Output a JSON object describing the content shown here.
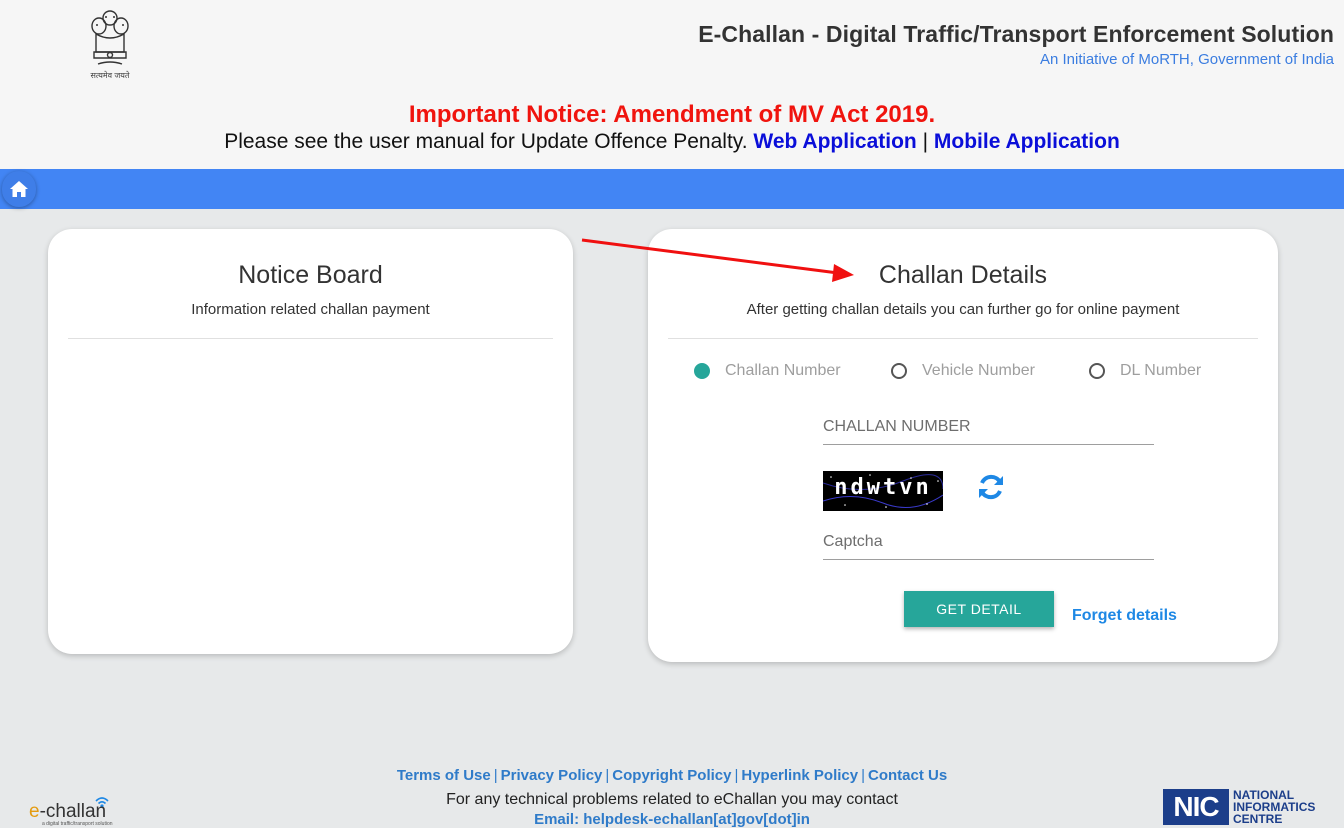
{
  "header": {
    "emblem_caption": "सत्यमेव जयते",
    "title": "E-Challan - Digital Traffic/Transport Enforcement Solution",
    "subtitle": "An Initiative of MoRTH, Government of India"
  },
  "notice": {
    "title": "Important Notice: Amendment of MV Act 2019.",
    "text": "Please see the user manual for Update Offence Penalty.",
    "web_link": "Web Application",
    "separator": "|",
    "mobile_link": "Mobile Application"
  },
  "navbar": {
    "home_icon": "home-icon",
    "color": "#4285f4"
  },
  "notice_board": {
    "title": "Notice Board",
    "subtitle": "Information related challan payment"
  },
  "challan": {
    "title": "Challan Details",
    "subtitle": "After getting challan details you can further go for online payment",
    "radio_options": [
      {
        "label": "Challan Number",
        "checked": true
      },
      {
        "label": "Vehicle Number",
        "checked": false
      },
      {
        "label": "DL Number",
        "checked": false
      }
    ],
    "number_input": {
      "placeholder": "CHALLAN NUMBER",
      "value": ""
    },
    "captcha_text": "ndwtvn",
    "captcha_input": {
      "placeholder": "Captcha",
      "value": ""
    },
    "submit_label": "GET DETAIL",
    "forget_label": "Forget details",
    "accent_color": "#26a69a"
  },
  "footer": {
    "links": [
      "Terms of Use",
      "Privacy Policy",
      "Copyright Policy",
      "Hyperlink Policy",
      "Contact Us"
    ],
    "link_separator": "|",
    "contact_text": "For any technical problems related to eChallan you may contact",
    "email": "Email: helpdesk-echallan[at]gov[dot]in",
    "logo_left": {
      "prefix": "e",
      "word": "-challan",
      "tagline": "a digital traffic/transport solution"
    },
    "logo_right": {
      "abbr": "NIC",
      "line1": "NATIONAL",
      "line2": "INFORMATICS",
      "line3": "CENTRE"
    }
  }
}
